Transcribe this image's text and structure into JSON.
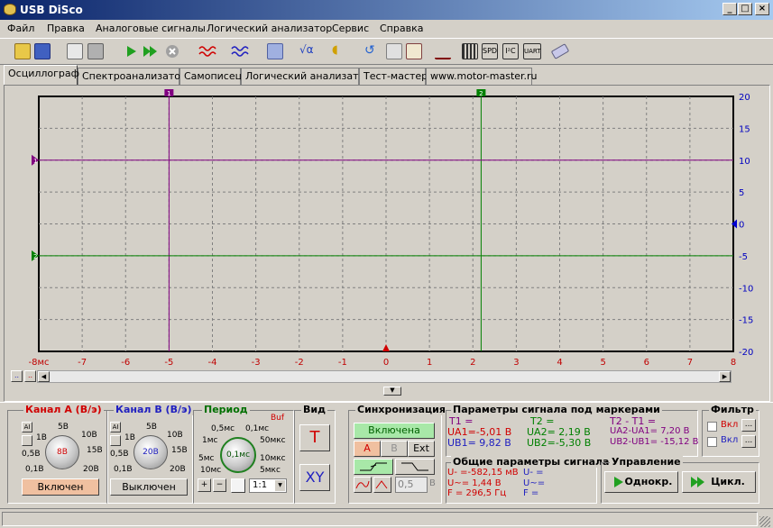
{
  "window": {
    "title": "USB DiSco",
    "minimize": "_",
    "maximize": "□",
    "close": "×"
  },
  "menu": [
    "Файл",
    "Правка",
    "Аналоговые сигналы",
    "Логический анализатор",
    "Сервис",
    "Справка"
  ],
  "toolbar_icons": [
    "open-icon",
    "save-icon",
    "print-preview-icon",
    "print-icon",
    "run-icon",
    "run-fast-icon",
    "stop-icon",
    "channel-a-icon",
    "channel-b-icon",
    "calculator-icon",
    "formula-icon",
    "sound-icon",
    "refresh-icon",
    "list-icon",
    "grid-icon",
    "scale-icon",
    "chip-icon",
    "spd-icon",
    "i2c-icon",
    "uart-icon",
    "eraser-icon"
  ],
  "chips": [
    "SPD",
    "I²C",
    "UART"
  ],
  "tabs": [
    "Осциллограф",
    "Спектроанализатор",
    "Самописец",
    "Логический анализатор",
    "Тест-мастер",
    "www.motor-master.ru"
  ],
  "plot": {
    "x_ticks": [
      "-8мс",
      "-7",
      "-6",
      "-5",
      "-4",
      "-3",
      "-2",
      "-1",
      "0",
      "1",
      "2",
      "3",
      "4",
      "5",
      "6",
      "7",
      "8"
    ],
    "y_ticks": [
      "20",
      "15",
      "10",
      "5",
      "0",
      "-5",
      "-10",
      "-15",
      "-20"
    ],
    "xlim": [
      -8,
      8
    ],
    "ylim": [
      -20,
      20
    ],
    "marker_t1": -5.0,
    "marker_t2": 2.19,
    "marker_u1": 10.0,
    "marker_u2": -5.0,
    "marker_t1_label": "1",
    "marker_t2_label": "2",
    "marker_u1_label": "1",
    "marker_u2_label": "2",
    "colors": {
      "purple": "#800080",
      "green": "#008000",
      "grid": "#808080",
      "bg": "#d4d0c8",
      "xtick": "#c00000",
      "ytick": "#0000c0"
    }
  },
  "scroll_btns": [
    " ..",
    ".."
  ],
  "chA": {
    "title": "Канал А (В/э)",
    "scale_labels": [
      "5В",
      "1В",
      "10В",
      "0,5В",
      "15В",
      "0,1В",
      "20В"
    ],
    "knob_value": "8В",
    "button": "Включен",
    "ai_label": "AI"
  },
  "chB": {
    "title": "Канал В (В/э)",
    "scale_labels": [
      "5В",
      "1В",
      "10В",
      "0,5В",
      "15В",
      "0,1В",
      "20В"
    ],
    "knob_value": "20В",
    "button": "Выключен",
    "ai_label": "AI"
  },
  "period": {
    "title": "Период",
    "buf": "Buf",
    "labels": [
      "0,5мс",
      "0,1мс",
      "1мс",
      "50мкс",
      "5мс",
      "10мкс",
      "10мс",
      "5мкс"
    ],
    "knob_value": "0,1мс",
    "ratio": "1:1"
  },
  "view": {
    "title": "Вид",
    "t_btn": "T",
    "xy_btn": "XY"
  },
  "sync": {
    "title": "Синхронизация",
    "state": "Включена",
    "a": "A",
    "b": "B",
    "ext": "Ext",
    "level": "0,5",
    "unit": "B"
  },
  "markers": {
    "title": "Параметры сигнала под маркерами",
    "col1": [
      "T1 =",
      "UA1=-5,01 В",
      "UB1= 9,82 В"
    ],
    "col2": [
      "T2 =",
      "UA2= 2,19 В",
      "UB2=-5,30 В"
    ],
    "col3": [
      "T2 - T1 =",
      "UA2-UA1= 7,20 В",
      "UB2-UB1= -15,12 В"
    ]
  },
  "common": {
    "title": "Общие параметры сигнала",
    "col1": [
      "U- =-582,15 мВ",
      "U~= 1,44 В",
      "F = 296,5 Гц"
    ],
    "col2": [
      "U- =",
      "U~=",
      "F ="
    ]
  },
  "filter": {
    "title": "Фильтр",
    "items": [
      "Вкл",
      "Вкл"
    ],
    "btn": "..."
  },
  "control": {
    "title": "Управление",
    "single": "Однокр.",
    "cycle": "Цикл."
  }
}
